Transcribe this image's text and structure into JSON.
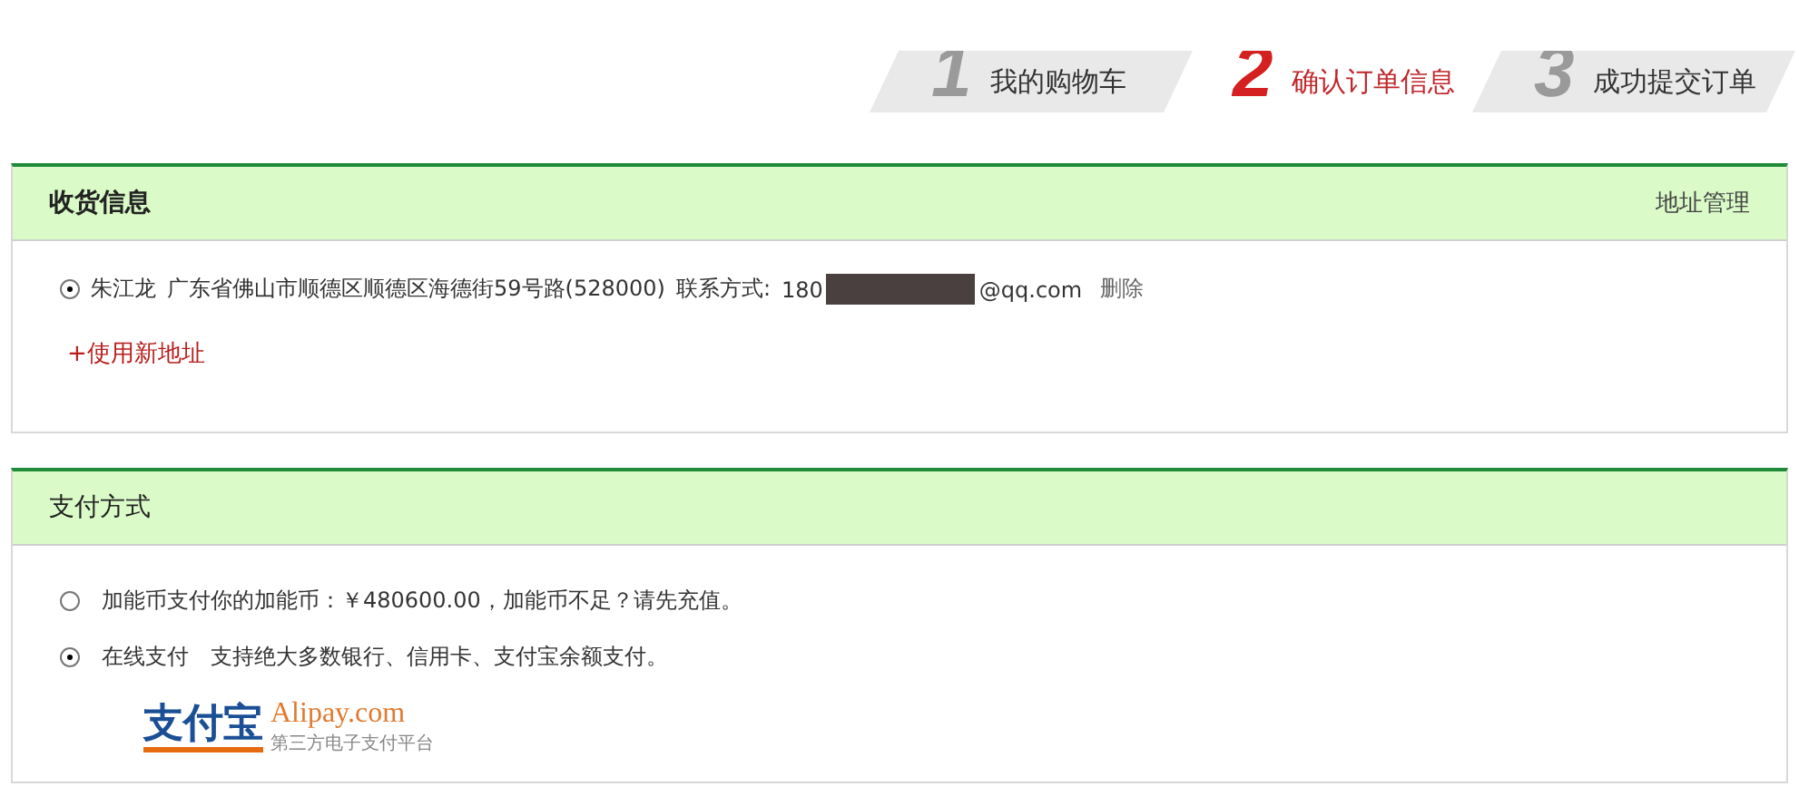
{
  "steps": [
    {
      "number": "1",
      "label": "我的购物车",
      "selected": false
    },
    {
      "number": "2",
      "label": "确认订单信息",
      "selected": true
    },
    {
      "number": "3",
      "label": "成功提交订单",
      "selected": false
    }
  ],
  "shipping": {
    "title": "收货信息",
    "manage_link": "地址管理",
    "addresses": [
      {
        "selected": true,
        "name": "朱江龙",
        "address": "广东省佛山市顺德区顺德区海德街59号路(528000)",
        "contact_label": "联系方式:",
        "contact_prefix": "180",
        "redacted": true,
        "contact_suffix": "@qq.com",
        "delete": "删除"
      }
    ],
    "add_link": "+使用新地址"
  },
  "payment": {
    "title": "支付方式",
    "options": [
      {
        "selected": false,
        "label": "加能币支付你的加能币：￥480600.00，加能币不足？请先充值。"
      },
      {
        "selected": true,
        "label": "在线支付　支持绝大多数银行、信用卡、支付宝余额支付。"
      }
    ],
    "logo": {
      "mark": "支付宝",
      "name": "Alipay.com",
      "tagline": "第三方电子支付平台"
    }
  }
}
